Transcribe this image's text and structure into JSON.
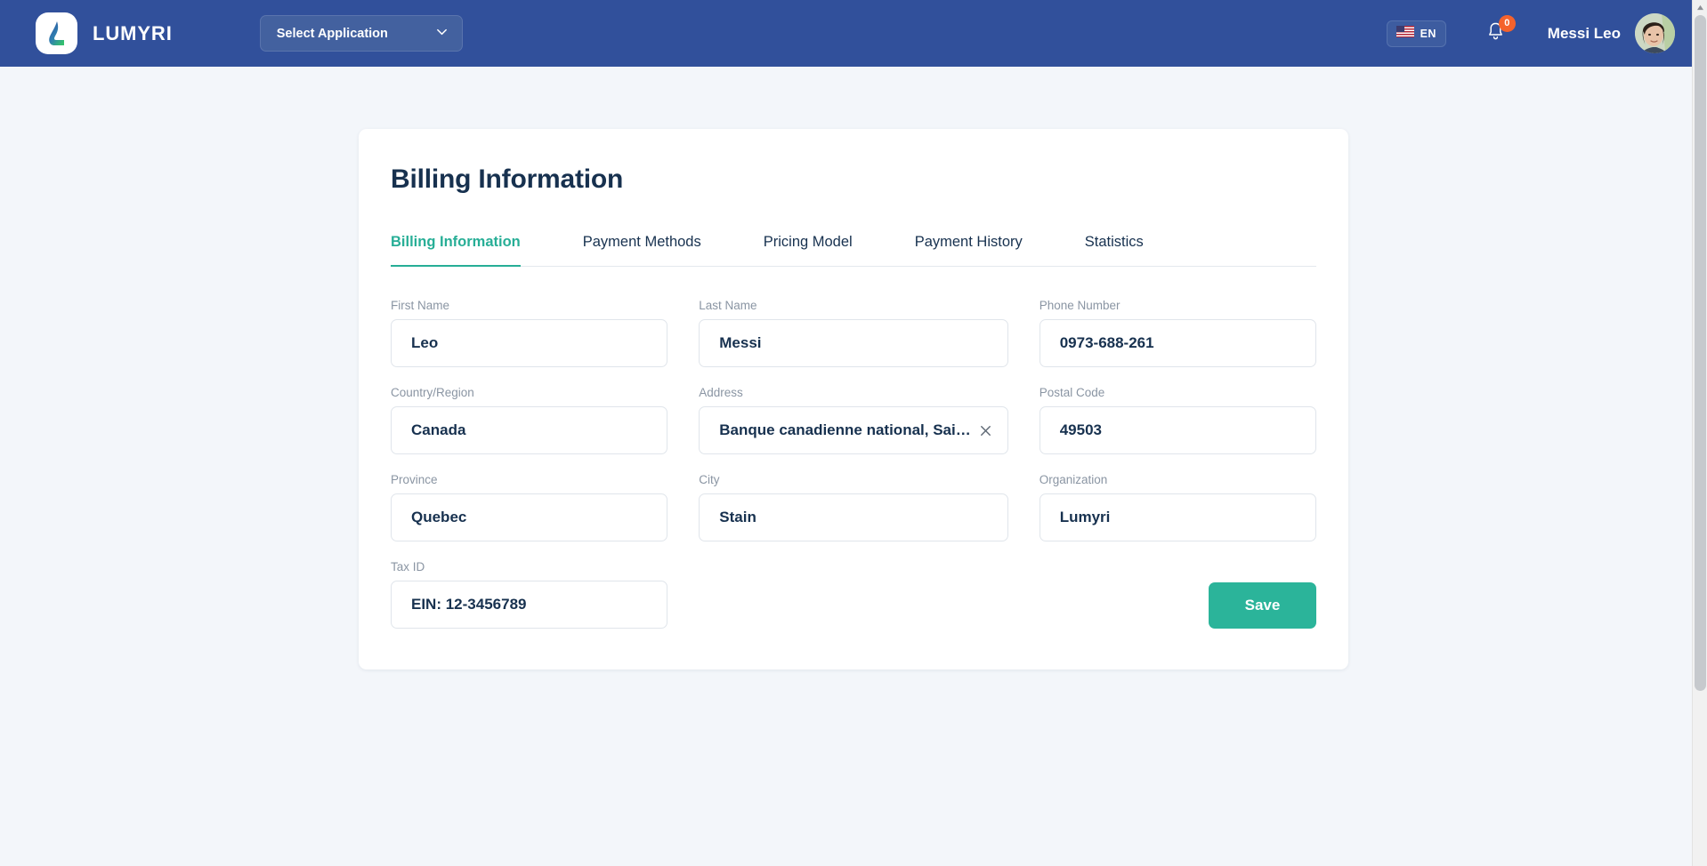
{
  "header": {
    "brand_name": "LUMYRI",
    "logo_icon": "lumyri-logo-icon",
    "app_select_label": "Select Application",
    "app_select_icon": "chevron-down-icon",
    "language": {
      "code": "EN",
      "flag_icon": "us-flag-icon"
    },
    "notifications": {
      "icon": "bell-icon",
      "count": "0",
      "badge_color": "#f4622c"
    },
    "user_name": "Messi Leo",
    "avatar_icon": "user-avatar",
    "background_color": "#31509b"
  },
  "card": {
    "title": "Billing Information",
    "tabs": [
      {
        "label": "Billing Information",
        "active": true
      },
      {
        "label": "Payment Methods",
        "active": false
      },
      {
        "label": "Pricing Model",
        "active": false
      },
      {
        "label": "Payment History",
        "active": false
      },
      {
        "label": "Statistics",
        "active": false
      }
    ],
    "accent_color": "#27ae96",
    "fields": [
      {
        "label": "First Name",
        "value": "Leo",
        "clearable": false
      },
      {
        "label": "Last Name",
        "value": "Messi",
        "clearable": false
      },
      {
        "label": "Phone Number",
        "value": "0973-688-261",
        "clearable": false
      },
      {
        "label": "Country/Region",
        "value": "Canada",
        "clearable": false
      },
      {
        "label": "Address",
        "value": "Banque canadienne national, Sai…",
        "clearable": true
      },
      {
        "label": "Postal Code",
        "value": "49503",
        "clearable": false
      },
      {
        "label": "Province",
        "value": "Quebec",
        "clearable": false
      },
      {
        "label": "City",
        "value": "Stain",
        "clearable": false
      },
      {
        "label": "Organization",
        "value": "Lumyri",
        "clearable": false
      },
      {
        "label": "Tax ID",
        "value": "EIN: 12-3456789",
        "clearable": false
      }
    ],
    "save_label": "Save",
    "save_color": "#2bb49a"
  },
  "scrollbar": {
    "up_arrow_icon": "scroll-up-arrow-icon"
  }
}
